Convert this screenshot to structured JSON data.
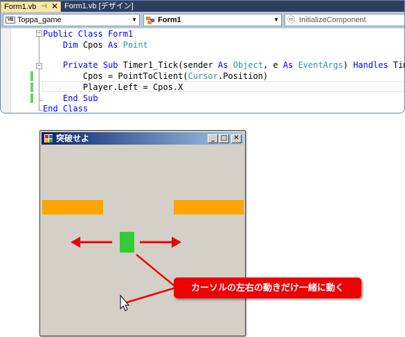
{
  "ide": {
    "tabs": [
      {
        "label": "Form1.vb",
        "pin": "⊣",
        "close": "✕"
      },
      {
        "label": "Form1.vb [デザイン]"
      }
    ],
    "nav": {
      "class_combo": {
        "badge": "VB",
        "value": "Toppa_game"
      },
      "object_combo": {
        "value": "Form1"
      },
      "member_combo": {
        "icon": "ⓜ",
        "value": "InitializeComponent"
      },
      "dropdown_arrow": "▼"
    },
    "code": {
      "line1": {
        "kw1": "Public",
        "kw2": "Class",
        "name": "Form1"
      },
      "line2": {
        "kw1": "Dim",
        "var": "Cpos",
        "kw2": "As",
        "type": "Point"
      },
      "line3": {
        "kw1": "Private",
        "kw2": "Sub",
        "sig": "Timer1_Tick(sender",
        "kw3": "As",
        "t1": "Object",
        "mid": ", e",
        "kw4": "As",
        "t2": "EventArgs",
        "post": ")",
        "kw5": "Handles",
        "tail": "Tim"
      },
      "line4": {
        "pre": "Cpos = PointToClient(",
        "type": "Cursor",
        "post": ".Position)"
      },
      "line5": {
        "text": "Player.Left = Cpos.X"
      },
      "line6": {
        "kw1": "End",
        "kw2": "Sub"
      },
      "line7": {
        "kw1": "End",
        "kw2": "Class"
      },
      "fold_minus": "−"
    }
  },
  "form": {
    "title": "突破せよ",
    "buttons": {
      "minimize": "_",
      "maximize": "□",
      "close": "✕"
    }
  },
  "annotation": {
    "callout": "カーソルの左右の動きだけ一緒に動く"
  },
  "colors": {
    "block": "#ffa500",
    "player": "#33cc33",
    "arrow": "#ee0000",
    "keyword": "#0000ff",
    "type": "#2b91af"
  },
  "icons": [
    "pin-icon",
    "close-icon",
    "vb-file-icon",
    "object-icon",
    "method-icon",
    "form-icon",
    "cursor-icon",
    "arrow-left-icon",
    "arrow-right-icon"
  ]
}
